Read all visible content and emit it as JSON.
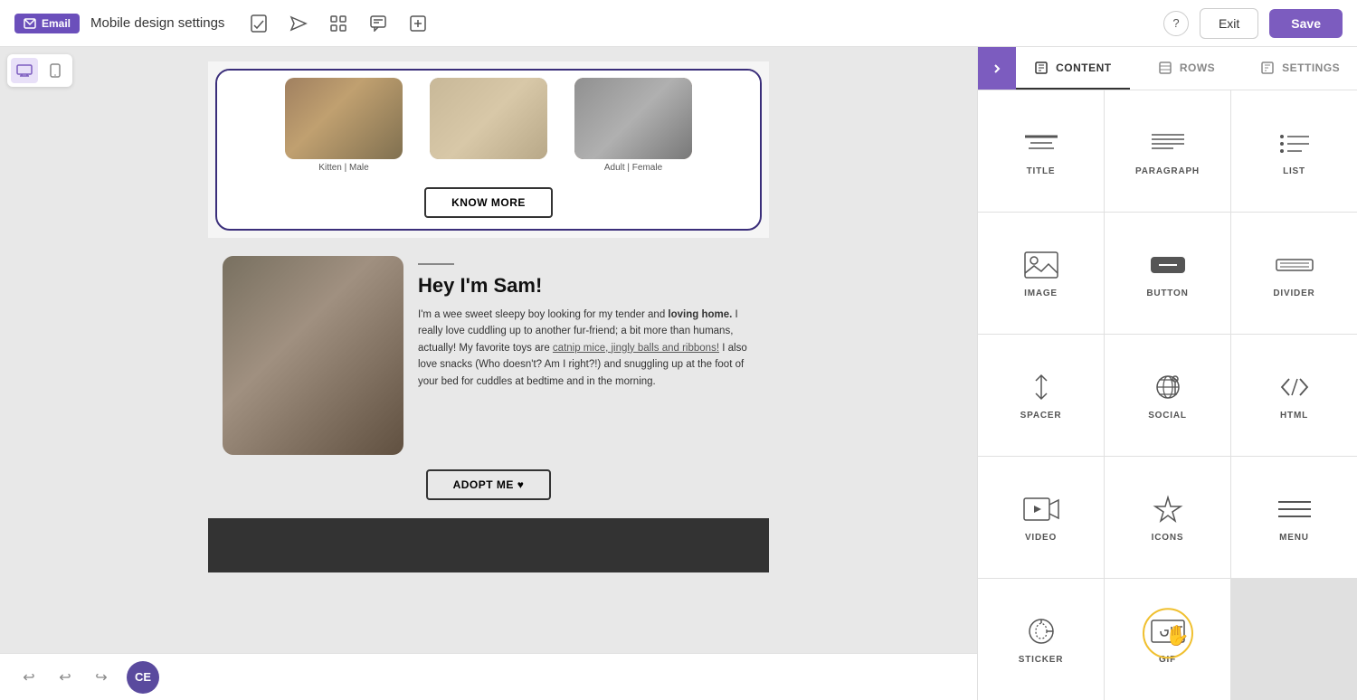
{
  "topbar": {
    "email_label": "Email",
    "title": "Mobile design settings",
    "exit_label": "Exit",
    "save_label": "Save"
  },
  "device_toggle": {
    "desktop_title": "Desktop view",
    "mobile_title": "Mobile view"
  },
  "canvas": {
    "pets": {
      "pet1": {
        "label": "Kitten | Male"
      },
      "pet2": {
        "label": ""
      },
      "pet3": {
        "label": "Adult | Female"
      },
      "know_more": "KNOW MORE"
    },
    "sam": {
      "title": "Hey I'm Sam!",
      "body_part1": "I'm a wee sweet sleepy boy looking for my tender and ",
      "bold": "loving home.",
      "body_part2": " I really love cuddling up to another fur-friend; a bit more than humans, actually! My favorite toys are ",
      "link_text": "catnip mice, jingly balls and ribbons!",
      "body_part3": " I also love snacks (Who doesn't? Am I right?!) and snuggling up at the foot of your bed for cuddles at bedtime and in the morning.",
      "adopt_btn": "ADOPT ME ♥"
    }
  },
  "right_panel": {
    "tab_content": "CONTENT",
    "tab_rows": "ROWS",
    "tab_settings": "SETTINGS",
    "cells": [
      {
        "id": "title",
        "label": "TITLE"
      },
      {
        "id": "paragraph",
        "label": "PARAGRAPH"
      },
      {
        "id": "list",
        "label": "LIST"
      },
      {
        "id": "image",
        "label": "IMAGE"
      },
      {
        "id": "button",
        "label": "BUTTON"
      },
      {
        "id": "divider",
        "label": "DIVIDER"
      },
      {
        "id": "spacer",
        "label": "SPACER"
      },
      {
        "id": "social",
        "label": "SOCIAL"
      },
      {
        "id": "html",
        "label": "HTML"
      },
      {
        "id": "video",
        "label": "VIDEO"
      },
      {
        "id": "icons",
        "label": "ICONS"
      },
      {
        "id": "menu",
        "label": "MENU"
      },
      {
        "id": "sticker",
        "label": "STICKER"
      },
      {
        "id": "gif",
        "label": "GIF",
        "highlighted": true
      }
    ]
  },
  "bottom_bar": {
    "avatar_initials": "CE"
  }
}
